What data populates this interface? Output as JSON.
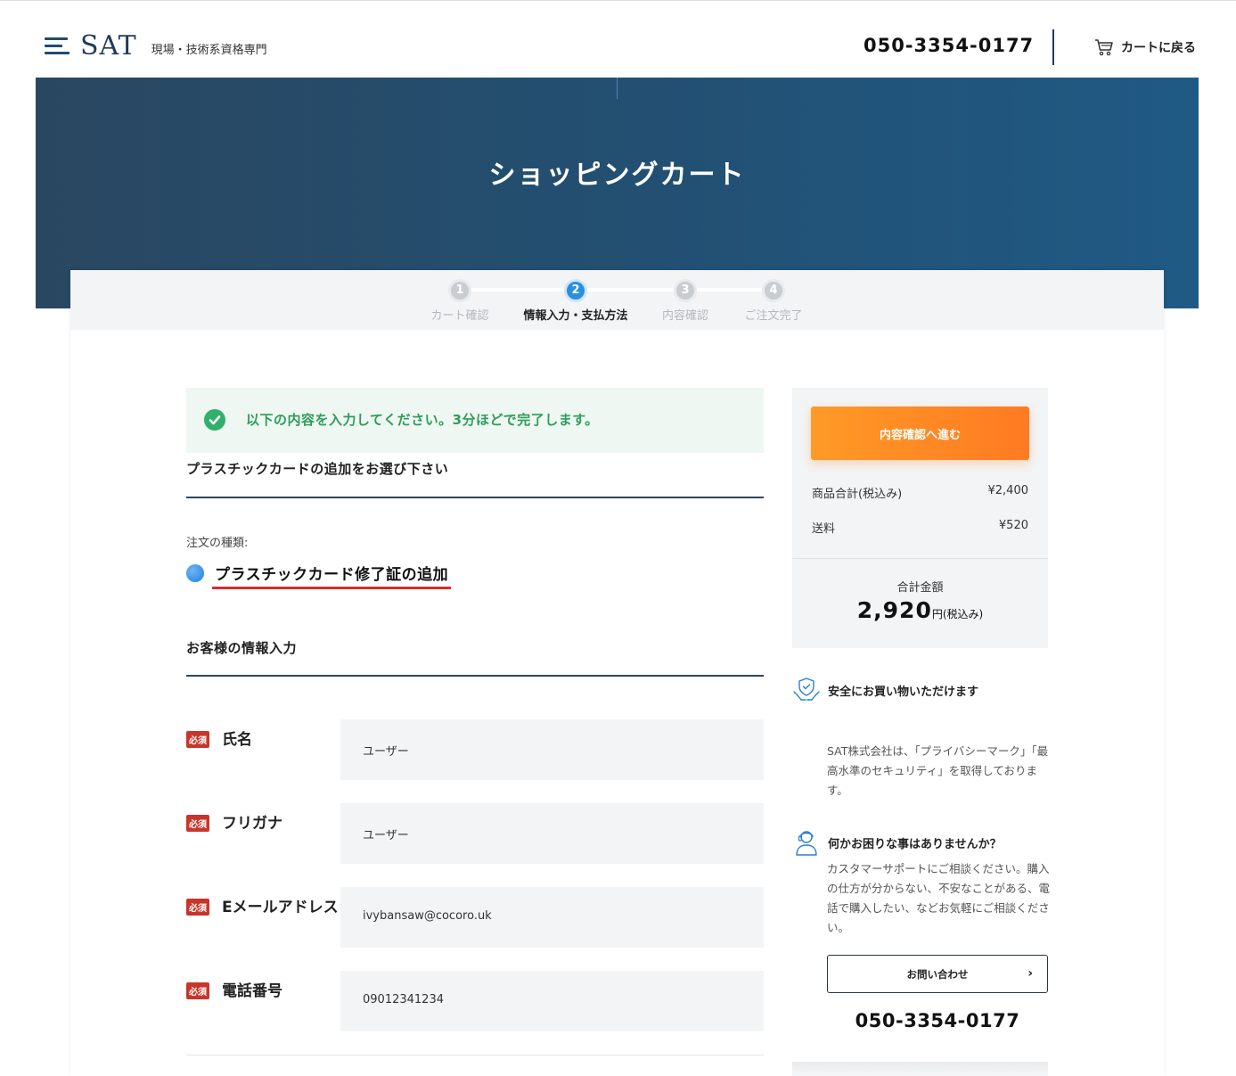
{
  "header": {
    "logo_text": "SAT",
    "logo_sub": "現場・技術系資格専門",
    "phone": "050-3354-0177",
    "cart_back": "カートに戻る"
  },
  "hero": {
    "title": "ショッピングカート"
  },
  "steps": [
    {
      "num": "1",
      "label": "カート確認",
      "active": false
    },
    {
      "num": "2",
      "label": "情報入力・支払方法",
      "active": true
    },
    {
      "num": "3",
      "label": "内容確認",
      "active": false
    },
    {
      "num": "4",
      "label": "ご注文完了",
      "active": false
    }
  ],
  "notice": {
    "text": "以下の内容を入力してください。3分ほどで完了します。",
    "color": "#2f9c5c"
  },
  "plastic": {
    "title": "プラスチックカードの追加をお選び下さい",
    "order_type_label": "注文の種類:",
    "order_type_value": "プラスチックカード修了証の追加"
  },
  "customer": {
    "title": "お客様の情報入力",
    "required_badge": "必須",
    "fields": [
      {
        "label": "氏名",
        "value": "ユーザー"
      },
      {
        "label": "フリガナ",
        "value": "ユーザー"
      },
      {
        "label": "Eメールアドレス",
        "value": "ivybansaw@cocoro.uk"
      },
      {
        "label": "電話番号",
        "value": "09012341234"
      }
    ]
  },
  "summary": {
    "proceed_label": "内容確認へ進む",
    "subtotal_label": "商品合計(税込み)",
    "subtotal_value": "¥2,400",
    "shipping_label": "送料",
    "shipping_value": "¥520",
    "total_label": "合計金額",
    "total_value": "2,920",
    "total_unit": "円(税込み)",
    "accent": "#ff8a24"
  },
  "sidebar": {
    "safe_title": "安全にお買い物いただけます",
    "safe_text": "SAT株式会社は、「プライバシーマーク」「最高水準のセキュリティ」を取得しております。",
    "help_title": "何かお困りな事はありませんか？",
    "help_text": "カスタマーサポートにご相談ください。購入の仕方が分からない、不安なことがある、電話で購入したい、などお気軽にご相談ください。",
    "contact_label": "お問い合わせ",
    "phone": "050-3354-0177"
  }
}
